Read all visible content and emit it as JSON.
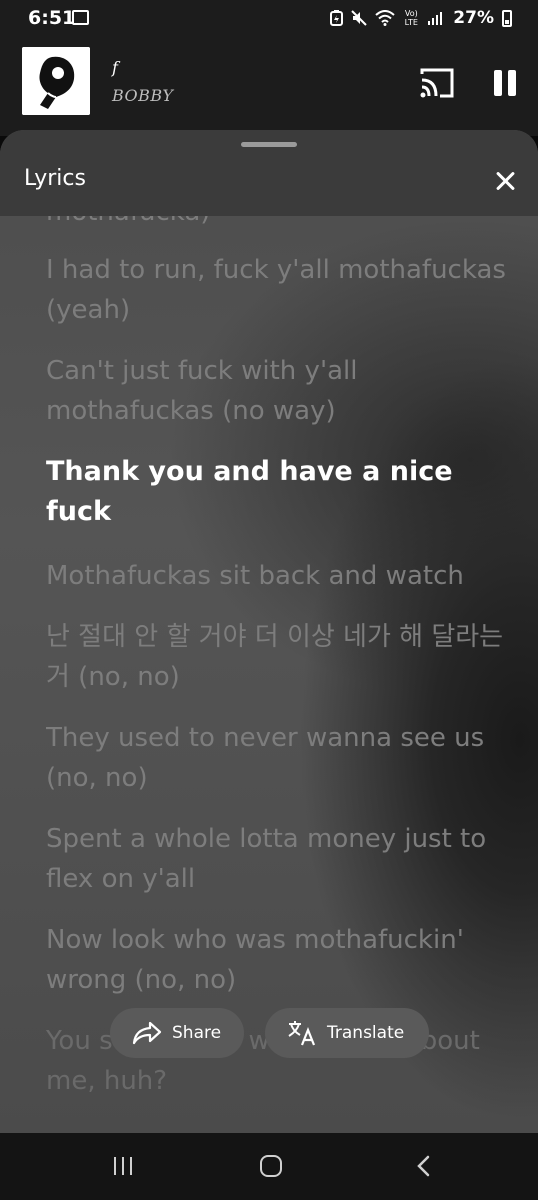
{
  "status_bar": {
    "time": "6:51",
    "battery_percent": "27%",
    "network_label": "Vo) LTE"
  },
  "player": {
    "track_title": "f",
    "artist": "BOBBY",
    "state": "playing"
  },
  "lyrics_sheet": {
    "title": "Lyrics",
    "lines": [
      {
        "text": "mothafucka)",
        "state": "past"
      },
      {
        "text": "I had to run, fuck y'all mothafuckas (yeah)",
        "state": "past"
      },
      {
        "text": "Can't just fuck with y'all mothafuckas (no way)",
        "state": "past"
      },
      {
        "text": "Thank you and have a nice fuck",
        "state": "active"
      },
      {
        "text": "Mothafuckas sit back and watch",
        "state": "upcoming"
      },
      {
        "text": "난 절대 안 할 거야 더 이상 네가 해 달라는 거 (no, no)",
        "state": "upcoming"
      },
      {
        "text": "They used to never wanna see us (no, no)",
        "state": "upcoming"
      },
      {
        "text": "Spent a whole lotta money just to flex on y'all",
        "state": "upcoming"
      },
      {
        "text": "Now look who was mothafuckin' wrong (no, no)",
        "state": "upcoming"
      },
      {
        "text": "You saying you was worried 'bout me, huh?",
        "state": "upcoming"
      }
    ]
  },
  "actions": {
    "share_label": "Share",
    "translate_label": "Translate"
  },
  "colors": {
    "active_lyric": "#ffffff",
    "inactive_lyric": "#7d7d7d",
    "sheet_header": "#3b3b3b",
    "background": "#1c1c1c"
  }
}
